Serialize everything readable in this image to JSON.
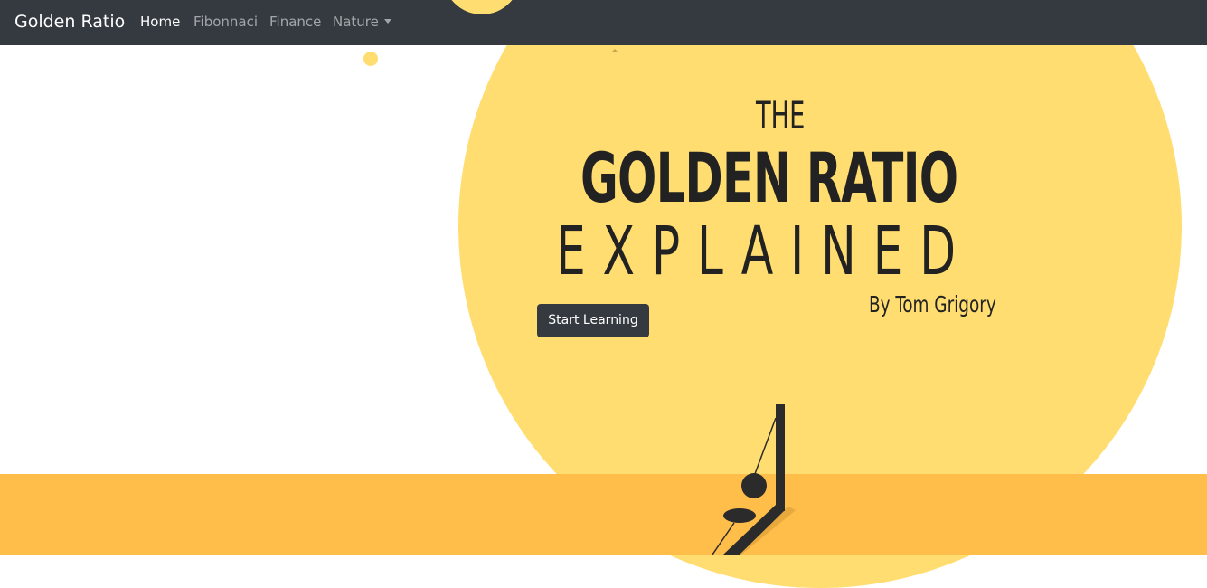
{
  "navbar": {
    "brand": "Golden Ratio",
    "links": [
      {
        "label": "Home",
        "active": true
      },
      {
        "label": "Fibonnaci",
        "active": false
      },
      {
        "label": "Finance",
        "active": false
      },
      {
        "label": "Nature",
        "active": false,
        "dropdown": true
      }
    ]
  },
  "hero": {
    "line1": "THE",
    "line2": "GOLDEN RATIO",
    "line3": "EXPLAINED",
    "byline": "By Tom Grigory",
    "cta_label": "Start Learning"
  },
  "colors": {
    "navbar": "#343a40",
    "sun": "#ffdd70",
    "ground": "#ffbd4a",
    "text": "#222222",
    "button": "#343a40"
  }
}
